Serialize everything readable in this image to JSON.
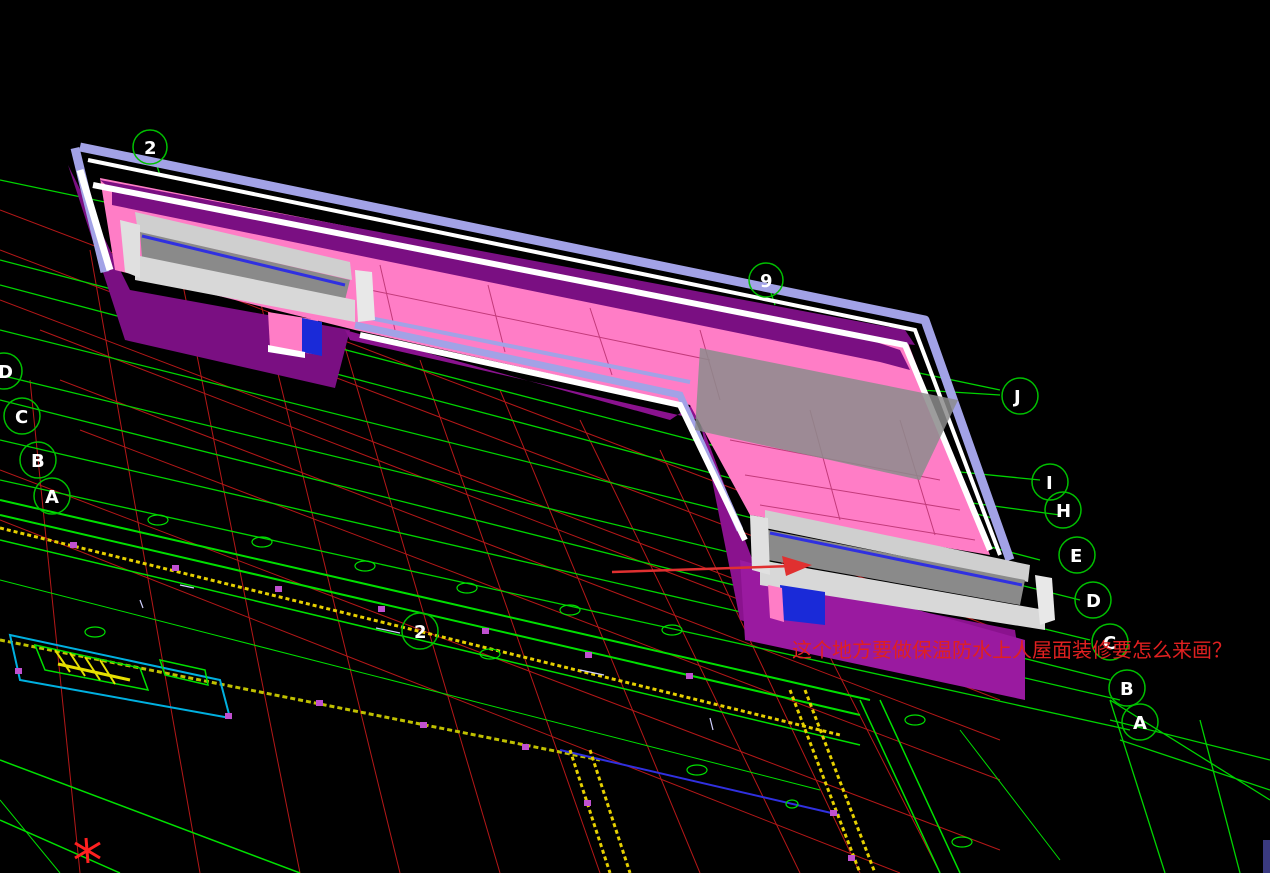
{
  "window": {
    "title": ""
  },
  "grid_axes": {
    "top": [
      "2",
      "9"
    ],
    "right": [
      "J",
      "I",
      "H",
      "E",
      "D",
      "C",
      "B",
      "A"
    ],
    "left": [
      "D",
      "C",
      "B",
      "A"
    ],
    "plan": [
      "2"
    ]
  },
  "annotation": {
    "text": "这个地方要做保温防水上人屋面装修要怎么来画？",
    "color": "#e02020"
  },
  "colors": {
    "background": "#000000",
    "grid_line": "#00d800",
    "plan_red": "#c01818",
    "wall_purple": "#7a1280",
    "floor_pink": "#ff80c8",
    "parapet_blue": "#9a9ad8",
    "arrow": "#e03030"
  },
  "icons": [
    "grid-axis-bubble",
    "arrow-pointer",
    "error-x-marker"
  ]
}
